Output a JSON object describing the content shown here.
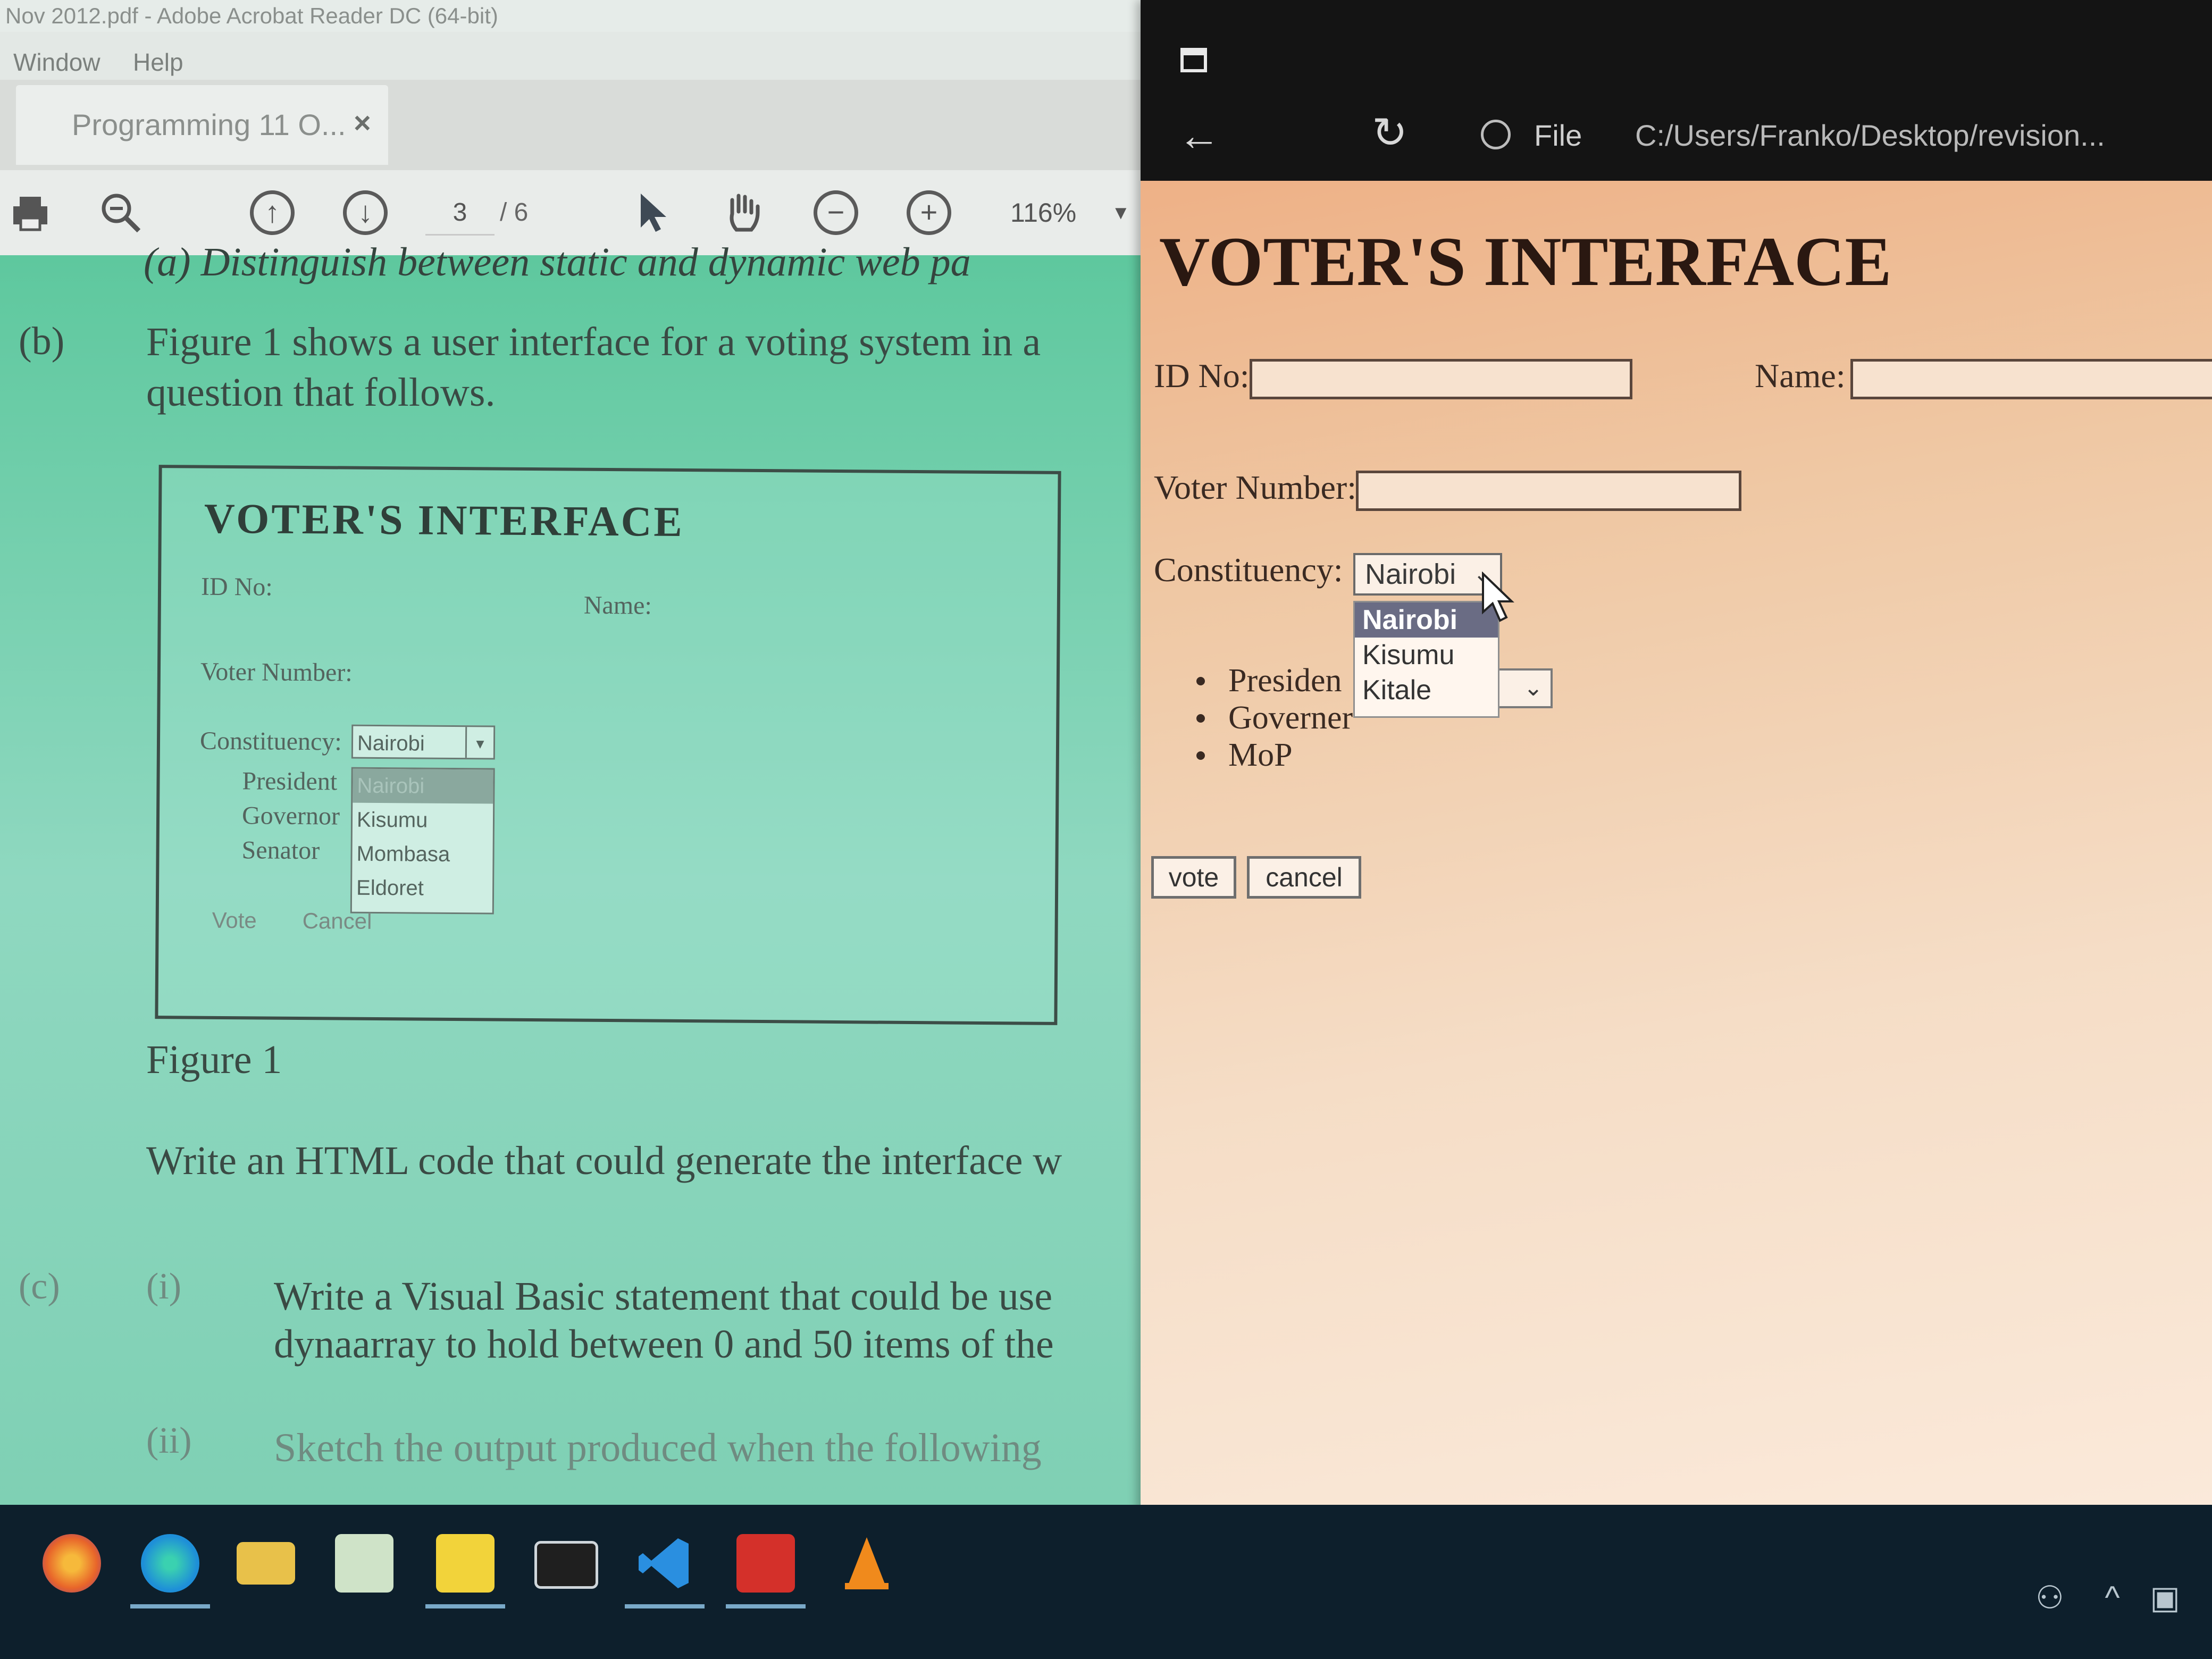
{
  "acrobat": {
    "title": "Nov 2012.pdf - Adobe Acrobat Reader DC (64-bit)",
    "menu": [
      "Window",
      "Help"
    ],
    "tab": {
      "label": "Programming 11 O...",
      "close": "×"
    },
    "toolbar": {
      "page_current": "3",
      "page_total": "/ 6",
      "zoom": "116%"
    },
    "page": {
      "line_top": "(a)   Distinguish between static and dynamic web pa",
      "item_b_label": "(b)",
      "item_b_line1": "Figure 1 shows a user interface for a voting system in a",
      "item_b_line2": "question that follows.",
      "figure": {
        "title": "VOTER'S INTERFACE",
        "id_label": "ID No:",
        "name_label": "Name:",
        "voter_label": "Voter Number:",
        "const_label": "Constituency:",
        "const_value": "Nairobi",
        "list_options": [
          "Nairobi",
          "Kisumu",
          "Mombasa",
          "Eldoret"
        ],
        "roles": [
          "President",
          "Governor",
          "Senator"
        ],
        "vote_btn": "Vote",
        "cancel_btn": "Cancel"
      },
      "figure_caption": "Figure 1",
      "write_html": "Write an HTML code that could generate the interface w",
      "item_c_label": "(c)",
      "c_i_label": "(i)",
      "c_i_line1": "Write a Visual Basic statement that could be use",
      "c_i_line2": "dynaarray to hold between 0 and 50 items of the",
      "c_ii_label": "(ii)",
      "c_ii_line1": "Sketch the output produced when the following"
    }
  },
  "browser": {
    "scheme": "File",
    "url": "C:/Users/Franko/Desktop/revision...",
    "page": {
      "title": "VOTER'S INTERFACE",
      "id_label": "ID No:",
      "name_label": "Name:",
      "voter_label": "Voter Number:",
      "const_label": "Constituency:",
      "const_selected": "Nairobi",
      "const_options": [
        "Nairobi",
        "Kisumu",
        "Kitale"
      ],
      "roles": [
        "Presiden",
        "Governer",
        "MoP"
      ],
      "vote_btn": "vote",
      "cancel_btn": "cancel"
    }
  },
  "taskbar": {
    "apps": [
      "firefox-icon",
      "edge-icon",
      "file-explorer-icon",
      "notepad-icon",
      "sticky-notes-icon",
      "terminal-icon",
      "vscode-icon",
      "acrobat-icon",
      "vlc-icon"
    ],
    "colors": {
      "firefox": "#e8652a",
      "edge": "#1e8fd8",
      "explorer": "#e8c14a",
      "vscode": "#2a8fe0",
      "acrobat": "#d4302a",
      "vlc": "#f08a1c"
    }
  }
}
